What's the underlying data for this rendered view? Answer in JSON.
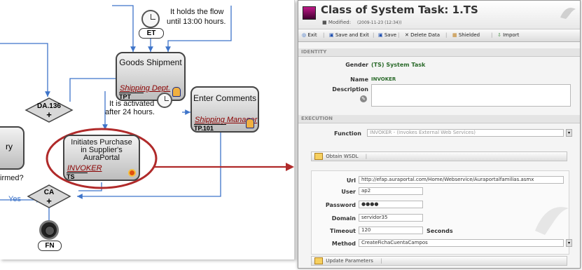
{
  "diagram": {
    "timer1_text_1": "It holds the flow",
    "timer1_text_2": "until 13:00 hours.",
    "et_label": "ET",
    "goods_shipment": {
      "title": "Goods Shipment",
      "role": "Shipping Dept.",
      "code": "TPT"
    },
    "enter_comments": {
      "title": "Enter Comments",
      "role": "Shipping Manager",
      "code": "TP.101"
    },
    "timer2_text_1": "It is activated",
    "timer2_text_2": "after 24 hours.",
    "da_label": "DA.136",
    "left_task_partial": "ry",
    "confirmed_partial": "irmed?",
    "yes_label": "Yes",
    "purchase_task": {
      "title_1": "Initiates Purchase",
      "title_2": "in Supplier's",
      "title_3": "AuraPortal",
      "role": "INVOKER",
      "code": "TS"
    },
    "ca_label": "CA",
    "fn_label": "FN"
  },
  "window": {
    "title": "Class of System Task: 1.TS",
    "modified_label": "Modified:",
    "modified_value": "(2009-11-23 (12:34))",
    "toolbar": {
      "exit": "Exit",
      "save_exit": "Save and Exit",
      "save": "Save",
      "delete": "Delete Data",
      "shielded": "Shielded",
      "import": "Import"
    },
    "identity_section": "IDENTITY",
    "gender_label": "Gender",
    "gender_value": "(TS) System Task",
    "name_label": "Name",
    "name_value": "INVOKER",
    "description_label": "Description",
    "description_value": "",
    "execution_section": "EXECUTION",
    "function_label": "Function",
    "function_value": "INVOKER - (Invokes External Web Services)",
    "obtain_wsdl": "Obtain WSDL",
    "url_label": "Url",
    "url_value": "http://efap.auraportal.com/Home/Webservice/Auraportalfamilias.asmx",
    "user_label": "User",
    "user_value": "ap2",
    "password_label": "Password",
    "password_value": "●●●●",
    "domain_label": "Domain",
    "domain_value": "servidor35",
    "timeout_label": "Timeout",
    "timeout_value": "120",
    "timeout_unit": "Seconds",
    "method_label": "Method",
    "method_value": "CreateFichaCuentaCampos",
    "update_parameters": "Update Parameters"
  },
  "colors": {
    "role_text": "#8a0000",
    "flow_line": "#3e74c9",
    "highlight_ellipse": "#b02a2a",
    "value_green": "#2a6a2a"
  }
}
